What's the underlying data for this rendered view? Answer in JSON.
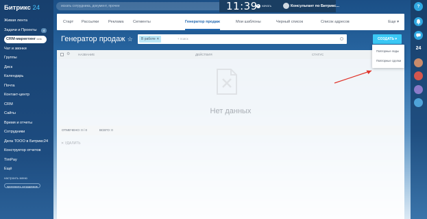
{
  "app": {
    "logo_name": "Битрикс",
    "logo_num": "24"
  },
  "sidebar": {
    "items": [
      {
        "label": "Живая лента"
      },
      {
        "label": "Задачи и Проекты",
        "counter": "4"
      },
      {
        "label": "CRM-маркетинг",
        "badge": "beta",
        "active": true
      },
      {
        "label": "Чат и звонки"
      },
      {
        "label": "Группы"
      },
      {
        "label": "Диск"
      },
      {
        "label": "Календарь"
      },
      {
        "label": "Почта"
      },
      {
        "label": "Контакт-центр"
      },
      {
        "label": "CRM"
      },
      {
        "label": "Сайты"
      },
      {
        "label": "Время и отчеты"
      },
      {
        "label": "Сотрудники"
      },
      {
        "label": "Дела ТООО в Битрикс24"
      },
      {
        "label": "Конструктор отчетов"
      },
      {
        "label": "TimPay"
      },
      {
        "label": "Ещё"
      }
    ],
    "settings_label": "настроить меню",
    "invite_label": "пригласить сотрудников"
  },
  "header": {
    "search_placeholder": "искать сотрудника, документ, прочее",
    "time": "11:39",
    "start_label": "начать",
    "user_name": "Консультант по Битрикс..."
  },
  "tabs": [
    {
      "label": "Старт"
    },
    {
      "label": "Рассылки"
    },
    {
      "label": "Реклама"
    },
    {
      "label": "Сегменты"
    },
    {
      "label": "Генератор продаж",
      "active": true
    },
    {
      "label": "Мои шаблоны"
    },
    {
      "label": "Черный список"
    },
    {
      "label": "Список адресов"
    }
  ],
  "tabs_more": "Еще",
  "page": {
    "title": "Генератор продаж",
    "filter_tag": "В работе",
    "filter_placeholder": "+ поиск",
    "create_label": "СОЗДАТЬ"
  },
  "grid": {
    "columns": [
      "НАЗВАНИЕ",
      "ДЕЙСТВИЯ",
      "СТАТУС"
    ],
    "empty_text": "Нет данных",
    "selected_label": "ОТМЕЧЕНО: 0 / 0",
    "total_label": "ВСЕГО: 0",
    "delete_label": "✕ УДАЛИТЬ"
  },
  "dropdown": {
    "items": [
      "Повторные лиды",
      "Повторные сделки"
    ]
  },
  "rightbar": {
    "help": "?",
    "counter": "24"
  },
  "colors": {
    "accent": "#3bc8f5",
    "active_tab": "#2067b0",
    "arrow": "#e0352b"
  }
}
